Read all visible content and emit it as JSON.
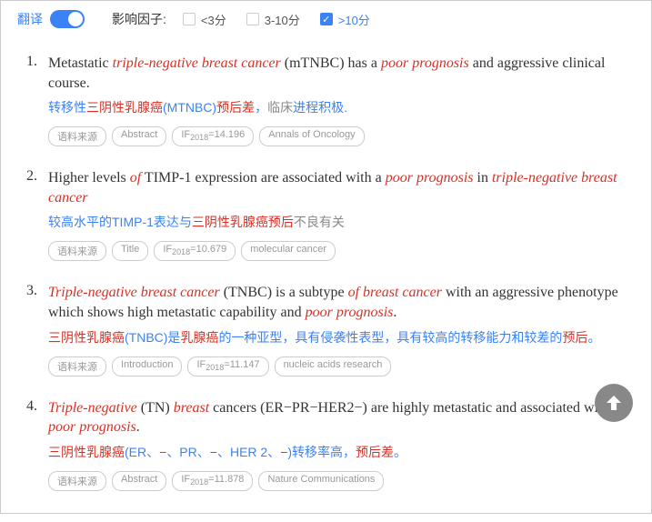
{
  "header": {
    "translate_label": "翻译",
    "filter_label": "影响因子:",
    "filters": [
      {
        "label": "<3分",
        "checked": false
      },
      {
        "label": "3-10分",
        "checked": false
      },
      {
        "label": ">10分",
        "checked": true
      }
    ]
  },
  "items": [
    {
      "num": "1.",
      "text_parts": [
        {
          "t": "Metastatic ",
          "hl": false
        },
        {
          "t": "triple-negative breast cancer",
          "hl": true
        },
        {
          "t": " (mTNBC) has a ",
          "hl": false
        },
        {
          "t": "poor prognosis",
          "hl": true
        },
        {
          "t": " and aggressive clinical course.",
          "hl": false
        }
      ],
      "trans_parts": [
        {
          "t": "转移性",
          "c": "blue"
        },
        {
          "t": "三阴性乳腺癌",
          "c": "red"
        },
        {
          "t": "(MTNBC)",
          "c": "blue"
        },
        {
          "t": "预后差",
          "c": "red"
        },
        {
          "t": "，",
          "c": "blue"
        },
        {
          "t": "临床",
          "c": "gray"
        },
        {
          "t": "进程积极.",
          "c": "blue"
        }
      ],
      "tags": [
        "语料来源",
        "Abstract",
        "IF2018=14.196",
        "Annals of Oncology"
      ]
    },
    {
      "num": "2.",
      "text_parts": [
        {
          "t": "Higher levels ",
          "hl": false
        },
        {
          "t": "of",
          "hl": true
        },
        {
          "t": " TIMP-1 expression are associated with a ",
          "hl": false
        },
        {
          "t": "poor prognosis",
          "hl": true
        },
        {
          "t": " in ",
          "hl": false
        },
        {
          "t": "triple-negative breast cancer",
          "hl": true
        }
      ],
      "trans_parts": [
        {
          "t": "较高水平的TIMP-1表达与",
          "c": "blue"
        },
        {
          "t": "三阴性乳腺癌预后",
          "c": "red"
        },
        {
          "t": "不良有关",
          "c": "gray"
        }
      ],
      "tags": [
        "语料来源",
        "Title",
        "IF2018=10.679",
        "molecular cancer"
      ]
    },
    {
      "num": "3.",
      "text_parts": [
        {
          "t": "Triple-negative breast cancer",
          "hl": true
        },
        {
          "t": " (TNBC) is a subtype ",
          "hl": false
        },
        {
          "t": "of breast cancer",
          "hl": true
        },
        {
          "t": " with an aggressive phenotype which shows high metastatic capability and ",
          "hl": false
        },
        {
          "t": "poor prognosis",
          "hl": true
        },
        {
          "t": ".",
          "hl": false
        }
      ],
      "trans_parts": [
        {
          "t": "三阴性乳腺癌",
          "c": "red"
        },
        {
          "t": "(TNBC)是",
          "c": "blue"
        },
        {
          "t": "乳腺癌",
          "c": "red"
        },
        {
          "t": "的一种亚型，具有侵袭性表型，具有较高的转移能力和较差的",
          "c": "blue"
        },
        {
          "t": "预后",
          "c": "red"
        },
        {
          "t": "。",
          "c": "blue"
        }
      ],
      "tags": [
        "语料来源",
        "Introduction",
        "IF2018=11.147",
        "nucleic acids research"
      ]
    },
    {
      "num": "4.",
      "text_parts": [
        {
          "t": "Triple-negative",
          "hl": true
        },
        {
          "t": " (TN) ",
          "hl": false
        },
        {
          "t": "breast",
          "hl": true
        },
        {
          "t": " cancers (ER−PR−HER2−) are highly metastatic and associated with ",
          "hl": false
        },
        {
          "t": "poor prognosis",
          "hl": true
        },
        {
          "t": ".",
          "hl": false
        }
      ],
      "trans_parts": [
        {
          "t": "三阴性乳腺癌",
          "c": "red"
        },
        {
          "t": "(ER、",
          "c": "blue"
        },
        {
          "t": "−",
          "c": "red"
        },
        {
          "t": "、PR、",
          "c": "blue"
        },
        {
          "t": "−",
          "c": "red"
        },
        {
          "t": "、HER 2、",
          "c": "blue"
        },
        {
          "t": "−",
          "c": "red"
        },
        {
          "t": ")转移率高，",
          "c": "blue"
        },
        {
          "t": "预后差",
          "c": "red"
        },
        {
          "t": "。",
          "c": "blue"
        }
      ],
      "tags": [
        "语料来源",
        "Abstract",
        "IF2018=11.878",
        "Nature Communications"
      ]
    }
  ]
}
